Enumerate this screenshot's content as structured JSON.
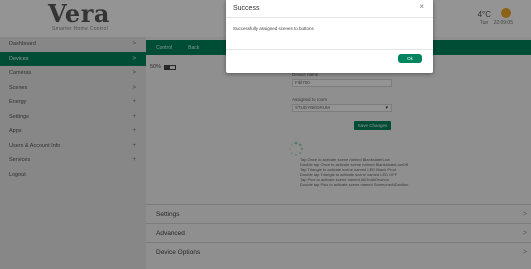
{
  "header": {
    "logo_word": "Vera",
    "logo_tagline": "Smarter Home Control",
    "temperature": "4°C",
    "weather_icon": "moon-icon",
    "day": "Tue",
    "time": "22:09:05"
  },
  "sidebar": {
    "items": [
      {
        "label": "Dashboard",
        "arrow": ">"
      },
      {
        "label": "Devices",
        "arrow": ">"
      },
      {
        "label": "Cameras",
        "arrow": ">"
      },
      {
        "label": "Scenes",
        "arrow": ">"
      },
      {
        "label": "Energy",
        "arrow": "+"
      },
      {
        "label": "Settings",
        "arrow": "+"
      },
      {
        "label": "Apps",
        "arrow": "+"
      },
      {
        "label": "Users & Account Info",
        "arrow": "+"
      },
      {
        "label": "Services",
        "arrow": "+"
      },
      {
        "label": "Logout",
        "arrow": ""
      }
    ],
    "active_index": 1
  },
  "device": {
    "tabs": [
      "Control",
      "Back"
    ],
    "battery_text": "50%",
    "battery_level": 0.5,
    "device_name_label": "Device name",
    "device_name_value": "Fibl700",
    "room_label": "Assigned to room",
    "room_value": "STUDYBEDRUM",
    "save_label": "Save Changes",
    "help_lines": [
      "Tap Once to activate scene named BlankslaterLow",
      "Double tap Once to activate scene named BlankslaterLowOff",
      "Tap Triangle to activate scene named LED Blank Prod",
      "Double tap Triangle to activate scene named LED OFF",
      "Tap Plus to activate scene named AllOnAllOnshon",
      "Double tap Plus to activate scene named SomeoneAtDoction"
    ]
  },
  "accordion": [
    {
      "label": "Settings",
      "arrow": ">"
    },
    {
      "label": "Advanced",
      "arrow": ">"
    },
    {
      "label": "Device Options",
      "arrow": ">"
    }
  ],
  "modal": {
    "title": "Success",
    "close": "×",
    "message": "Successfully assigned scenes to buttons",
    "ok_label": "Ok"
  },
  "colors": {
    "accent": "#00855e",
    "weather_accent": "#f4a72a"
  }
}
